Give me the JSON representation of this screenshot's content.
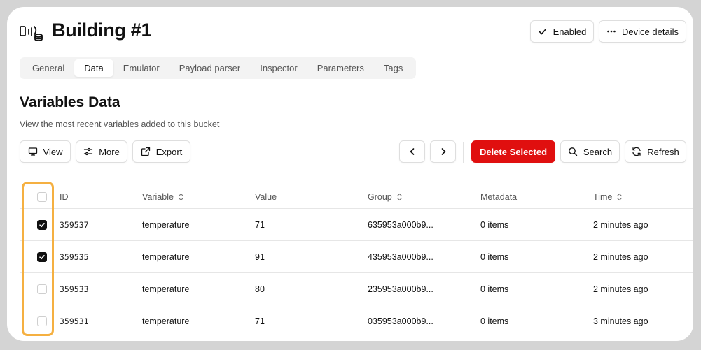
{
  "header": {
    "device_icon": "iot-device-icon",
    "title": "Building #1",
    "enabled_label": "Enabled",
    "device_details_label": "Device details"
  },
  "tabs": [
    {
      "label": "General",
      "active": false
    },
    {
      "label": "Data",
      "active": true
    },
    {
      "label": "Emulator",
      "active": false
    },
    {
      "label": "Payload parser",
      "active": false
    },
    {
      "label": "Inspector",
      "active": false
    },
    {
      "label": "Parameters",
      "active": false
    },
    {
      "label": "Tags",
      "active": false
    }
  ],
  "section": {
    "title": "Variables Data",
    "subtitle": "View the most recent variables added to this bucket"
  },
  "toolbar": {
    "view_label": "View",
    "more_label": "More",
    "export_label": "Export",
    "delete_label": "Delete Selected",
    "search_label": "Search",
    "refresh_label": "Refresh",
    "danger_color": "#e00f0f"
  },
  "table": {
    "columns": [
      "ID",
      "Variable",
      "Value",
      "Group",
      "Metadata",
      "Time"
    ],
    "rows": [
      {
        "id": "359537",
        "variable": "temperature",
        "value": "71",
        "group": "635953a000b9...",
        "metadata": "0 items",
        "time": "2 minutes ago",
        "checked": true
      },
      {
        "id": "359535",
        "variable": "temperature",
        "value": "91",
        "group": "435953a000b9...",
        "metadata": "0 items",
        "time": "2 minutes ago",
        "checked": true
      },
      {
        "id": "359533",
        "variable": "temperature",
        "value": "80",
        "group": "235953a000b9...",
        "metadata": "0 items",
        "time": "2 minutes ago",
        "checked": false
      },
      {
        "id": "359531",
        "variable": "temperature",
        "value": "71",
        "group": "035953a000b9...",
        "metadata": "0 items",
        "time": "3 minutes ago",
        "checked": false
      }
    ]
  },
  "highlight_color": "#f5b041"
}
